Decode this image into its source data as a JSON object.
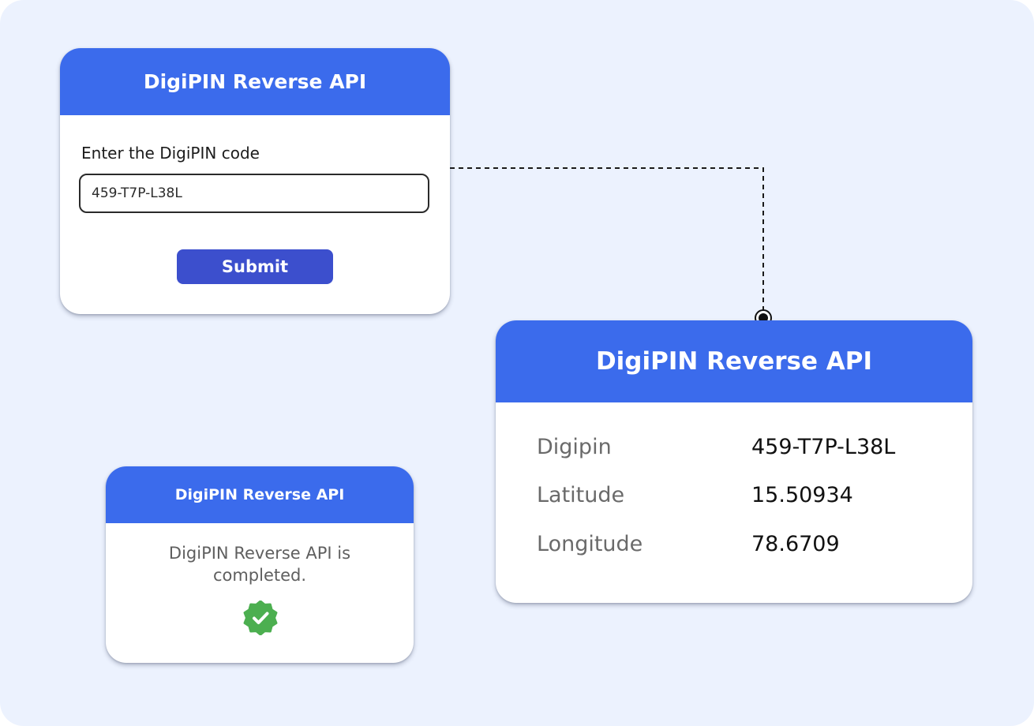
{
  "input_card": {
    "title": "DigiPIN Reverse API",
    "field_label": "Enter the DigiPIN code",
    "field_value": "459-T7P-L38L",
    "submit_label": "Submit"
  },
  "result_card": {
    "title": "DigiPIN Reverse API",
    "rows": [
      {
        "key": "Digipin",
        "value": "459-T7P-L38L"
      },
      {
        "key": "Latitude",
        "value": "15.50934"
      },
      {
        "key": "Longitude",
        "value": "78.6709"
      }
    ]
  },
  "status_card": {
    "title": "DigiPIN Reverse API",
    "message": "DigiPIN Reverse API is completed.",
    "icon": "verified-check-icon"
  },
  "colors": {
    "background": "#ecf2fe",
    "header_blue": "#3b6bec",
    "button_blue": "#3c4fcd",
    "success_green": "#4caf50"
  }
}
